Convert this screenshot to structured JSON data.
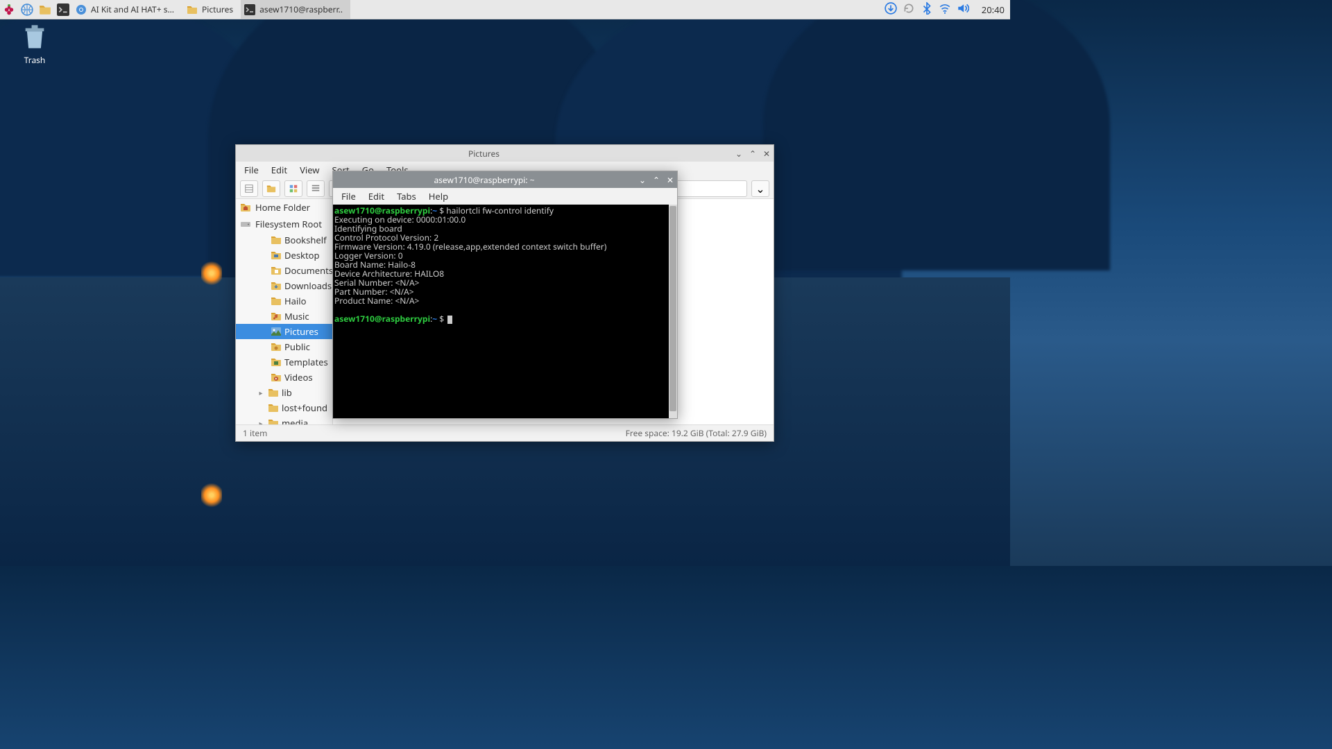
{
  "taskbar": {
    "tasks": [
      {
        "icon": "chromium",
        "label": "AI Kit and AI HAT+ so.."
      },
      {
        "icon": "folder",
        "label": "Pictures"
      },
      {
        "icon": "terminal",
        "label": "asew1710@raspberr.."
      }
    ],
    "clock": "20:40"
  },
  "desktop": {
    "trash_label": "Trash"
  },
  "fm": {
    "title": "Pictures",
    "menu": [
      "File",
      "Edit",
      "View",
      "Sort",
      "Go",
      "Tools"
    ],
    "places": {
      "home": "Home Folder",
      "fsroot": "Filesystem Root"
    },
    "tree": {
      "children": [
        "Bookshelf",
        "Desktop",
        "Documents",
        "Downloads",
        "Hailo",
        "Music",
        "Pictures",
        "Public",
        "Templates",
        "Videos"
      ],
      "siblings": [
        "lib",
        "lost+found",
        "media"
      ]
    },
    "selected": "Pictures",
    "status_left": "1 item",
    "status_right": "Free space: 19.2 GiB (Total: 27.9 GiB)"
  },
  "term": {
    "title": "asew1710@raspberrypi: ~",
    "menu": [
      "File",
      "Edit",
      "Tabs",
      "Help"
    ],
    "prompt": {
      "user": "asew1710@raspberrypi",
      "sep": ":",
      "path": "~",
      "sym": " $ "
    },
    "cmd": "hailortcli fw-control identify",
    "out": [
      "Executing on device: 0000:01:00.0",
      "Identifying board",
      "Control Protocol Version: 2",
      "Firmware Version: 4.19.0 (release,app,extended context switch buffer)",
      "Logger Version: 0",
      "Board Name: Hailo-8",
      "Device Architecture: HAILO8",
      "Serial Number: <N/A>",
      "Part Number: <N/A>",
      "Product Name: <N/A>"
    ]
  }
}
